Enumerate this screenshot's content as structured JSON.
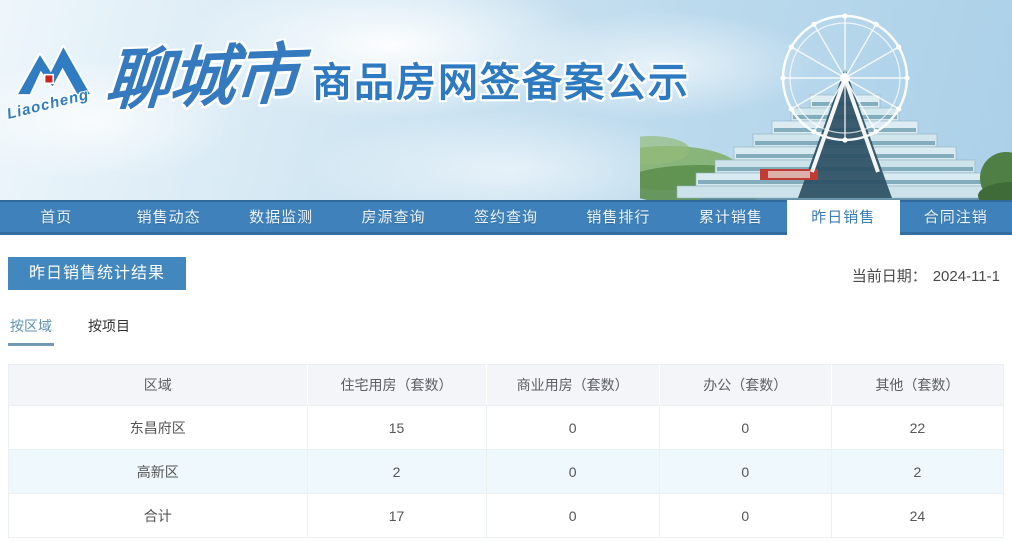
{
  "header": {
    "logo_text": "Liaocheng",
    "brand_script": "聊城市",
    "brand_title": "商品房网签备案公示"
  },
  "nav": {
    "items": [
      {
        "label": "首页",
        "active": false
      },
      {
        "label": "销售动态",
        "active": false
      },
      {
        "label": "数据监测",
        "active": false
      },
      {
        "label": "房源查询",
        "active": false
      },
      {
        "label": "签约查询",
        "active": false
      },
      {
        "label": "销售排行",
        "active": false
      },
      {
        "label": "累计销售",
        "active": false
      },
      {
        "label": "昨日销售",
        "active": true
      },
      {
        "label": "合同注销",
        "active": false
      }
    ]
  },
  "page": {
    "section_title": "昨日销售统计结果",
    "date_label": "当前日期：",
    "date_value": "2024-11-1"
  },
  "tabs": [
    {
      "label": "按区域",
      "active": true
    },
    {
      "label": "按项目",
      "active": false
    }
  ],
  "table": {
    "headers": [
      "区域",
      "住宅用房（套数）",
      "商业用房（套数）",
      "办公（套数）",
      "其他（套数）"
    ],
    "rows": [
      {
        "region": "东昌府区",
        "values": [
          "15",
          "0",
          "0",
          "22"
        ]
      },
      {
        "region": "高新区",
        "values": [
          "2",
          "0",
          "0",
          "2"
        ]
      },
      {
        "region": "合计",
        "values": [
          "17",
          "0",
          "0",
          "24"
        ]
      }
    ]
  },
  "colors": {
    "nav_blue": "#3f82bb",
    "banner_blue": "#4287bd",
    "brand_blue": "#2e7ac0",
    "stripe_row": "#eff8fd",
    "table_header_bg": "#f4f5f8"
  }
}
